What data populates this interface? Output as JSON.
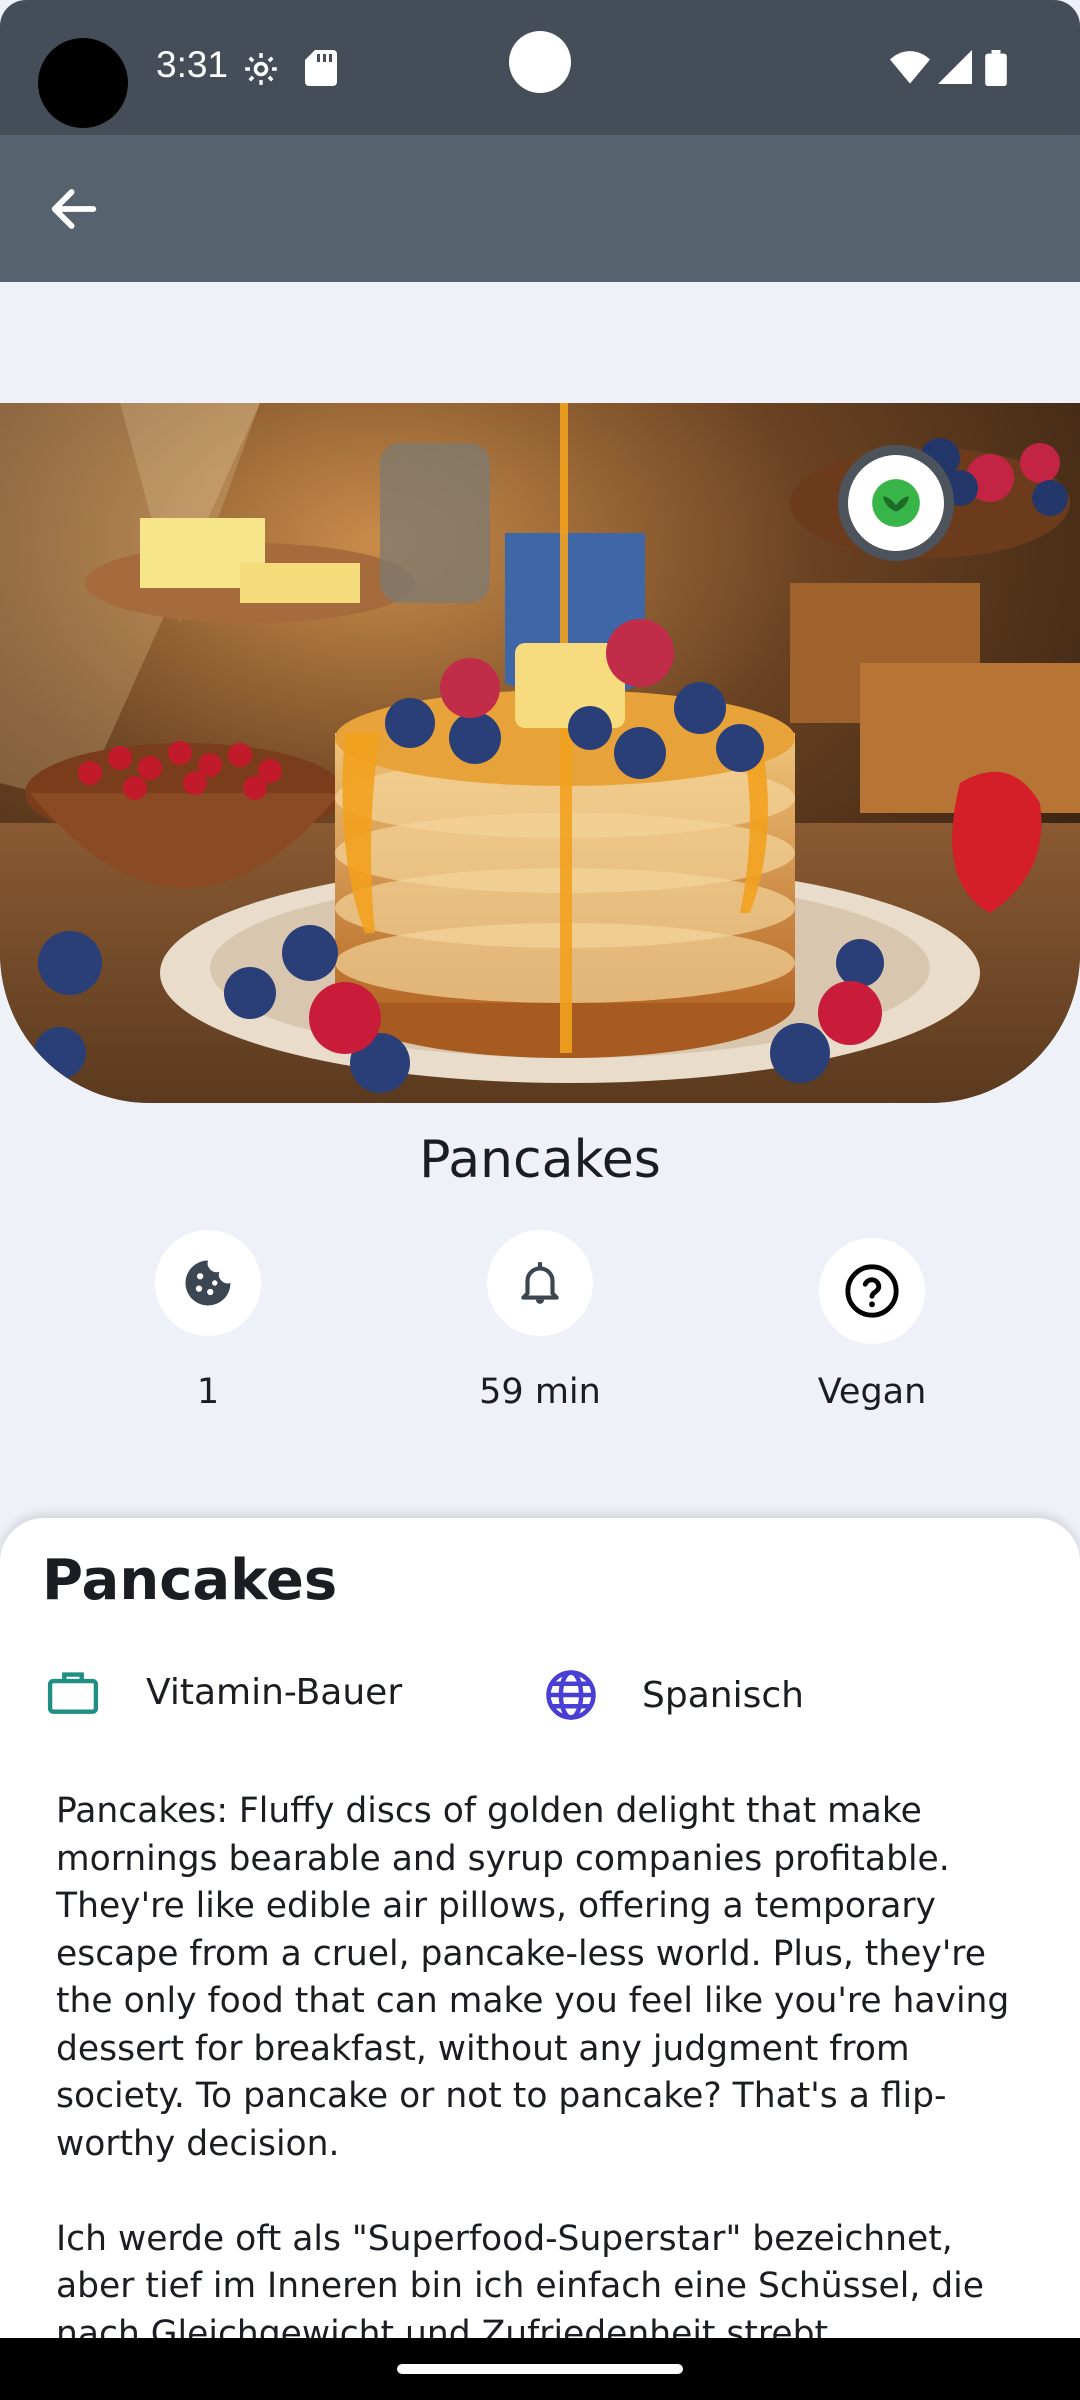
{
  "status_bar": {
    "time": "3:31",
    "icons": [
      "settings-icon",
      "sd-card-icon",
      "wifi-icon",
      "signal-icon",
      "battery-icon"
    ]
  },
  "app_bar": {
    "back_icon": "arrow-back-icon"
  },
  "hero": {
    "image": "pancake-stack-photo",
    "badge_icon": "vegan-leaf-icon"
  },
  "recipe": {
    "title": "Pancakes",
    "stats": [
      {
        "icon": "cookie-icon",
        "value": "1"
      },
      {
        "icon": "bell-icon",
        "value": "59 min"
      },
      {
        "icon": "help-circle-icon",
        "value": "Vegan"
      }
    ]
  },
  "sheet": {
    "title": "Pancakes",
    "author": "Vitamin-Bauer",
    "author_icon": "briefcase-icon",
    "language": "Spanisch",
    "language_icon": "globe-icon",
    "description": "Pancakes: Fluffy discs of golden delight that make mornings bearable and syrup companies profitable. They're like edible air pillows, offering a temporary escape from a cruel, pancake-less world. Plus, they're the only food that can make you feel like you're having dessert for breakfast, without any judgment from society. To pancake or not to pancake? That's a flip-worthy decision.\n\nIch werde oft als \"Superfood-Superstar\" bezeichnet, aber tief im Inneren bin ich einfach eine Schüssel, die nach Gleichgewicht und Zufriedenheit strebt."
  },
  "colors": {
    "status_bar": "#454d58",
    "app_bar": "#56636f",
    "background": "#eef1f7",
    "author_icon": "#1e8f82",
    "language_icon": "#4a3fd4",
    "vegan_green": "#38b549"
  }
}
